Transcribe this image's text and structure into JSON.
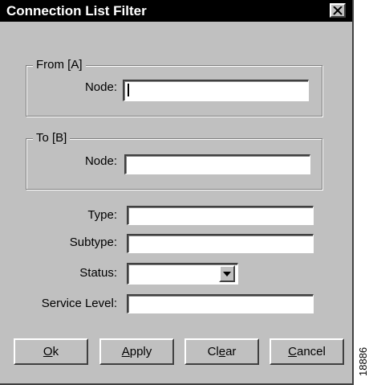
{
  "window": {
    "title": "Connection List Filter",
    "close_icon": "close-icon"
  },
  "from_group": {
    "label": "From [A]",
    "node_label": "Node:",
    "node_value": ""
  },
  "to_group": {
    "label": "To [B]",
    "node_label": "Node:",
    "node_value": ""
  },
  "fields": {
    "type": {
      "label": "Type:",
      "value": ""
    },
    "subtype": {
      "label": "Subtype:",
      "value": ""
    },
    "status": {
      "label": "Status:",
      "value": ""
    },
    "service_level": {
      "label": "Service Level:",
      "value": ""
    }
  },
  "buttons": {
    "ok": {
      "mnemonic": "O",
      "rest": "k"
    },
    "apply": {
      "mnemonic": "A",
      "rest": "pply"
    },
    "clear": {
      "pre": "Cl",
      "mnemonic": "e",
      "rest": "ar"
    },
    "cancel": {
      "mnemonic": "C",
      "rest": "ancel"
    }
  },
  "figure_id": "18886",
  "colors": {
    "dialog_bg": "#c0c0c0",
    "titlebar_bg": "#000000",
    "title_text": "#ffffff",
    "field_bg": "#ffffff"
  }
}
